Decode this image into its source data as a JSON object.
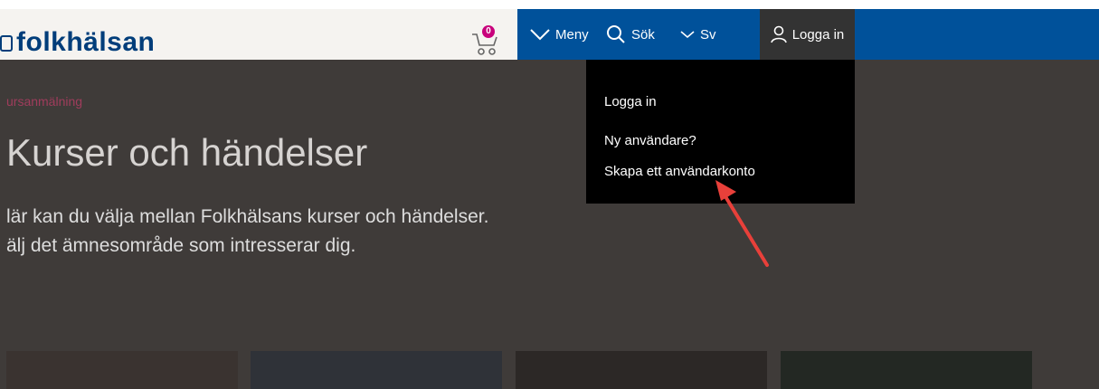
{
  "header": {
    "logo_text": "folkhälsan",
    "cart_count": "0"
  },
  "nav": {
    "menu_label": "Meny",
    "search_label": "Sök",
    "language_label": "Sv",
    "login_label": "Logga in"
  },
  "dropdown": {
    "items": [
      {
        "label": "Logga in"
      },
      {
        "label": "Ny användare?"
      },
      {
        "label": "Skapa ett användarkonto"
      }
    ]
  },
  "main": {
    "breadcrumb": "ursanmälning",
    "title": "Kurser och händelser",
    "intro_line1": "lär kan du välja mellan Folkhälsans kurser och händelser.",
    "intro_line2": "älj det ämnesområde som intresserar dig."
  },
  "colors": {
    "nav_blue": "#00519a",
    "brand_blue": "#003d7a",
    "badge_pink": "#c8007c",
    "arrow_red": "#e8403a"
  }
}
